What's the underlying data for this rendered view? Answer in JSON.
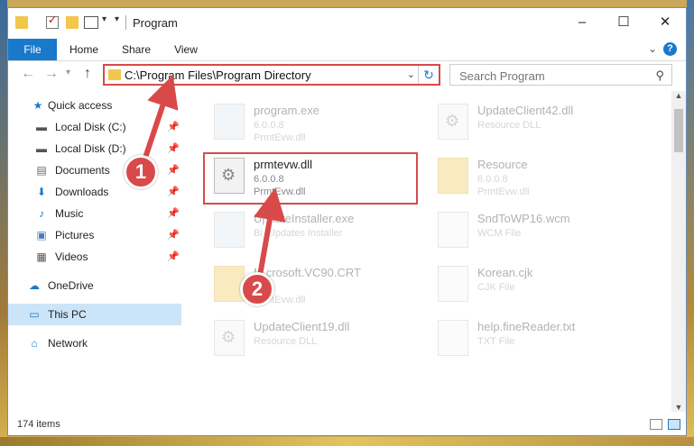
{
  "window": {
    "title": "Program",
    "controls": {
      "minimize": "–",
      "maximize": "☐",
      "close": "✕"
    }
  },
  "ribbon": {
    "tabs": [
      "File",
      "Home",
      "Share",
      "View"
    ],
    "help": "?"
  },
  "nav": {
    "address": "C:\\Program Files\\Program Directory",
    "search_placeholder": "Search Program"
  },
  "sidebar": {
    "items": [
      {
        "label": "Quick access",
        "icon": "star-icon",
        "pinned": false
      },
      {
        "label": "Local Disk (C:)",
        "icon": "drive-icon",
        "pinned": true
      },
      {
        "label": "Local Disk (D:)",
        "icon": "drive-icon",
        "pinned": true
      },
      {
        "label": "Documents",
        "icon": "documents-icon",
        "pinned": true
      },
      {
        "label": "Downloads",
        "icon": "download-icon",
        "pinned": true
      },
      {
        "label": "Music",
        "icon": "music-icon",
        "pinned": true
      },
      {
        "label": "Pictures",
        "icon": "pictures-icon",
        "pinned": true
      },
      {
        "label": "Videos",
        "icon": "videos-icon",
        "pinned": true
      },
      {
        "label": "OneDrive",
        "icon": "cloud-icon",
        "pinned": false
      },
      {
        "label": "This PC",
        "icon": "computer-icon",
        "pinned": false,
        "selected": true
      },
      {
        "label": "Network",
        "icon": "network-icon",
        "pinned": false
      }
    ]
  },
  "files": [
    {
      "name": "program.exe",
      "line1": "6.0.0.8",
      "line2": "PrmtEvw.dll",
      "kind": "exe",
      "faded": true
    },
    {
      "name": "UpdateClient42.dll",
      "line1": "Resource DLL",
      "line2": "",
      "kind": "dll",
      "faded": true
    },
    {
      "name": "prmtevw.dll",
      "line1": "6.0.0.8",
      "line2": "PrmtEvw.dll",
      "kind": "dll",
      "faded": false
    },
    {
      "name": "Resource",
      "line1": "6.0.0.8",
      "line2": "PrmtEvw.dll",
      "kind": "folder",
      "faded": true
    },
    {
      "name": "UpdateInstaller.exe",
      "line1": "Bit Updates Installer",
      "line2": "",
      "kind": "exe",
      "faded": true
    },
    {
      "name": "SndToWP16.wcm",
      "line1": "WCM File",
      "line2": "",
      "kind": "file",
      "faded": true
    },
    {
      "name": "Microsoft.VC90.CRT",
      "line1": "",
      "line2": "PrmtEvw.dll",
      "kind": "folder",
      "faded": true
    },
    {
      "name": "Korean.cjk",
      "line1": "CJK File",
      "line2": "",
      "kind": "file",
      "faded": true
    },
    {
      "name": "UpdateClient19.dll",
      "line1": "Resource DLL",
      "line2": "",
      "kind": "dll",
      "faded": true
    },
    {
      "name": "help.fineReader.txt",
      "line1": "TXT File",
      "line2": "",
      "kind": "file",
      "faded": true
    }
  ],
  "status": {
    "count": "174 items"
  },
  "callouts": {
    "step1": "1",
    "step2": "2"
  },
  "colors": {
    "accent": "#1979ca",
    "highlight": "#d84a4a",
    "selected": "#cce4f7"
  }
}
